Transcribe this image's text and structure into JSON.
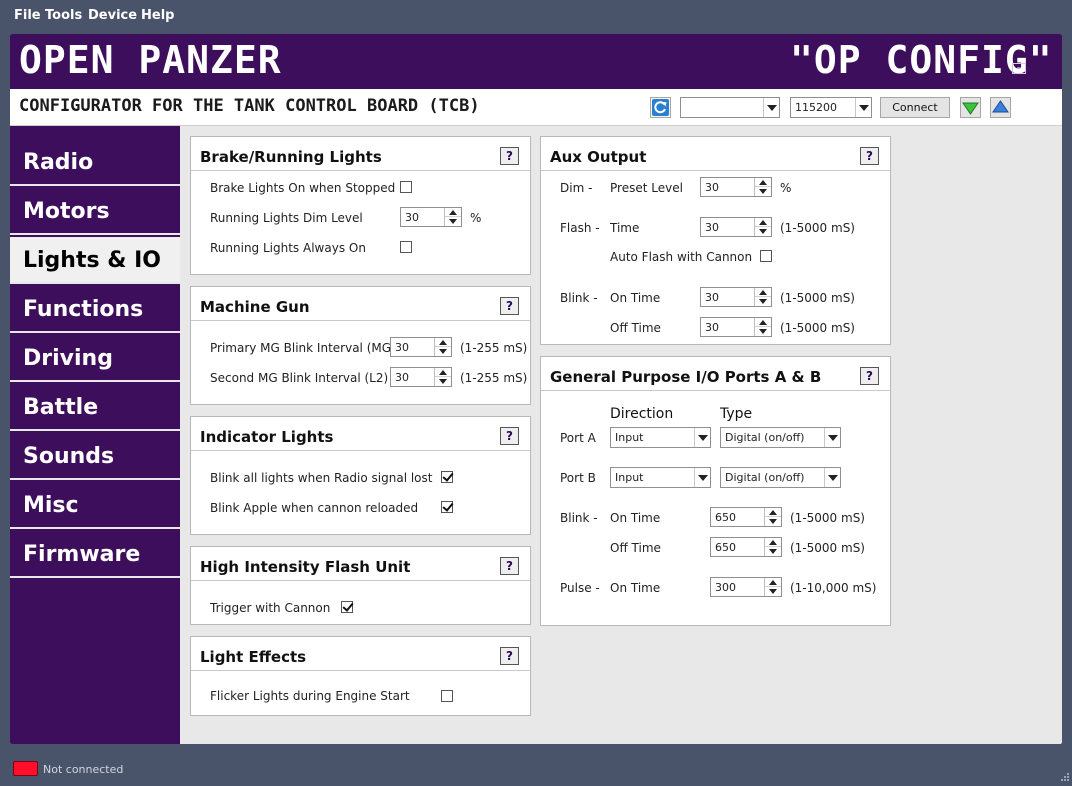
{
  "menu": [
    "File",
    "Tools",
    "Device",
    "Help"
  ],
  "app": {
    "title": "OPEN PANZER",
    "title_right": "\"OP CONFIG\"",
    "subtitle": "CONFIGURATOR FOR THE TANK CONTROL BOARD (TCB)"
  },
  "toolbar": {
    "port_value": "",
    "baud_value": "115200",
    "connect_label": "Connect"
  },
  "nav": {
    "items": [
      "Radio",
      "Motors",
      "Lights & IO",
      "Functions",
      "Driving",
      "Battle",
      "Sounds",
      "Misc",
      "Firmware"
    ],
    "active": "Lights & IO"
  },
  "brake": {
    "title": "Brake/Running Lights",
    "brake_on_stopped_label": "Brake Lights On when Stopped",
    "brake_on_stopped": false,
    "dim_label": "Running Lights Dim Level",
    "dim_value": "30",
    "dim_unit": "%",
    "always_on_label": "Running Lights Always On",
    "always_on": false
  },
  "mg": {
    "title": "Machine Gun",
    "primary_label": "Primary MG Blink Interval (MG)",
    "primary_value": "30",
    "primary_range": "(1-255 mS)",
    "second_label": "Second MG Blink Interval (L2)",
    "second_value": "30",
    "second_range": "(1-255 mS)"
  },
  "indicator": {
    "title": "Indicator Lights",
    "radio_lost_label": "Blink all lights when Radio signal lost",
    "radio_lost": true,
    "apple_label": "Blink Apple when cannon reloaded",
    "apple": true
  },
  "hiflash": {
    "title": "High Intensity Flash Unit",
    "trigger_label": "Trigger with Cannon",
    "trigger": true
  },
  "effects": {
    "title": "Light Effects",
    "flicker_label": "Flicker Lights during Engine Start",
    "flicker": false
  },
  "aux": {
    "title": "Aux Output",
    "dim_label": "Dim -",
    "preset_label": "Preset Level",
    "preset_value": "30",
    "preset_unit": "%",
    "flash_label": "Flash -",
    "time_label": "Time",
    "time_value": "30",
    "time_range": "(1-5000 mS)",
    "auto_flash_label": "Auto Flash with Cannon",
    "auto_flash": false,
    "blink_label": "Blink -",
    "on_time_label": "On Time",
    "on_time_value": "30",
    "on_time_range": "(1-5000 mS)",
    "off_time_label": "Off Time",
    "off_time_value": "30",
    "off_time_range": "(1-5000 mS)"
  },
  "gpio": {
    "title": "General Purpose I/O Ports A & B",
    "direction_header": "Direction",
    "type_header": "Type",
    "port_a_label": "Port A",
    "port_a_direction": "Input",
    "port_a_type": "Digital (on/off)",
    "port_b_label": "Port B",
    "port_b_direction": "Input",
    "port_b_type": "Digital (on/off)",
    "blink_label": "Blink -",
    "on_time_label": "On Time",
    "on_time_value": "650",
    "on_time_range": "(1-5000 mS)",
    "off_time_label": "Off Time",
    "off_time_value": "650",
    "off_time_range": "(1-5000 mS)",
    "pulse_label": "Pulse -",
    "pulse_on_label": "On Time",
    "pulse_on_value": "300",
    "pulse_on_range": "(1-10,000 mS)"
  },
  "help_label": "?",
  "status": {
    "text": "Not connected",
    "color": "#ff0f2b"
  }
}
